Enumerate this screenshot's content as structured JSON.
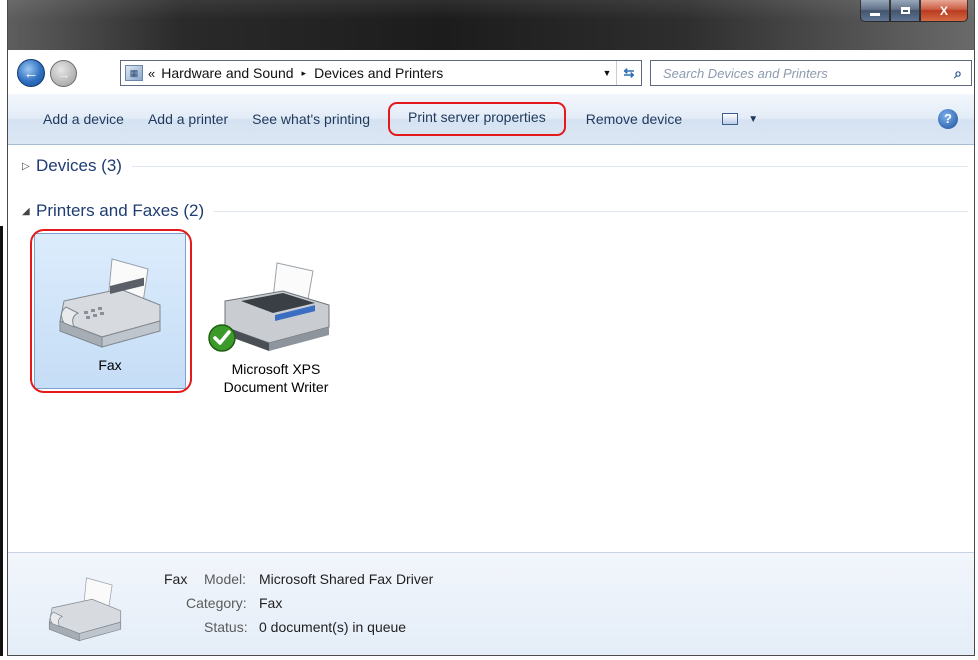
{
  "window": {
    "controls": {
      "close_label": "X"
    }
  },
  "nav": {
    "back_glyph": "←",
    "forward_glyph": "→",
    "address": {
      "overflow": "«",
      "crumbs": [
        "Hardware and Sound",
        "Devices and Printers"
      ],
      "separator": "▸"
    },
    "search_placeholder": "Search Devices and Printers"
  },
  "toolbar": {
    "add_device": "Add a device",
    "add_printer": "Add a printer",
    "see_printing": "See what's printing",
    "print_server": "Print server properties",
    "remove_device": "Remove device",
    "help_glyph": "?"
  },
  "groups": {
    "devices": {
      "label": "Devices (3)",
      "expanded": false
    },
    "printers": {
      "label": "Printers and Faxes (2)",
      "expanded": true
    }
  },
  "items": [
    {
      "lines": [
        "Fax"
      ],
      "icon": "fax-machine-icon",
      "selected": true
    },
    {
      "lines": [
        "Microsoft XPS",
        "Document Writer"
      ],
      "icon": "printer-icon",
      "default": true
    }
  ],
  "details": {
    "name": "Fax",
    "model_key": "Model:",
    "model_value": "Microsoft Shared Fax Driver",
    "category_key": "Category:",
    "category_value": "Fax",
    "status_key": "Status:",
    "status_value": "0 document(s) in queue"
  },
  "colors": {
    "highlight_ring": "#e3191b",
    "toolbar_text": "#1e395b",
    "group_text": "#1e3c72"
  }
}
